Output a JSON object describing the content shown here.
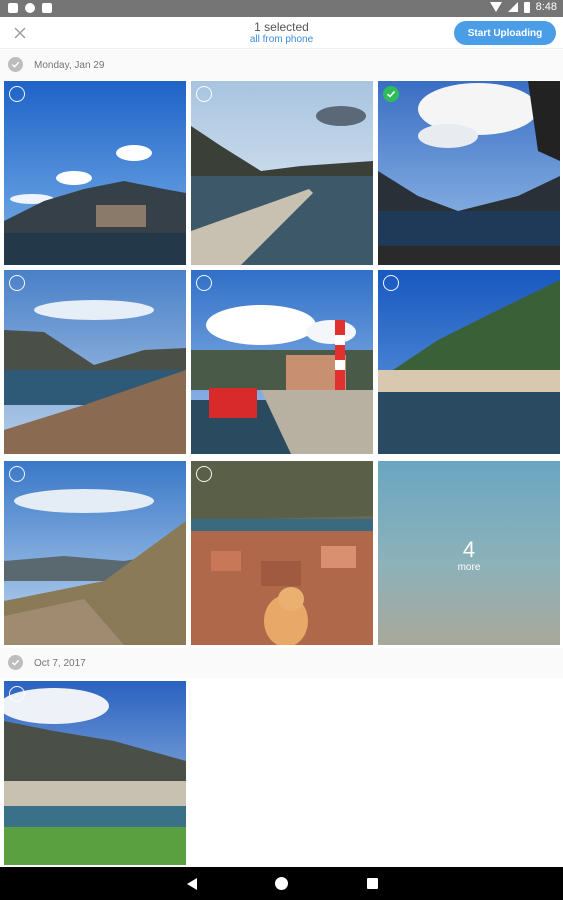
{
  "status_bar": {
    "time": "8:48"
  },
  "header": {
    "title": "1 selected",
    "subtitle": "all from phone",
    "upload_label": "Start Uploading"
  },
  "sections": [
    {
      "date": "Monday, Jan 29"
    },
    {
      "date": "Oct 7, 2017"
    }
  ],
  "more_tile": {
    "count": "4",
    "label": "more"
  },
  "selection": {
    "photos": [
      false,
      false,
      true,
      false,
      false,
      false,
      false,
      false,
      false
    ]
  },
  "colors": {
    "accent": "#4a9ee8",
    "selected": "#2ebd5a"
  }
}
